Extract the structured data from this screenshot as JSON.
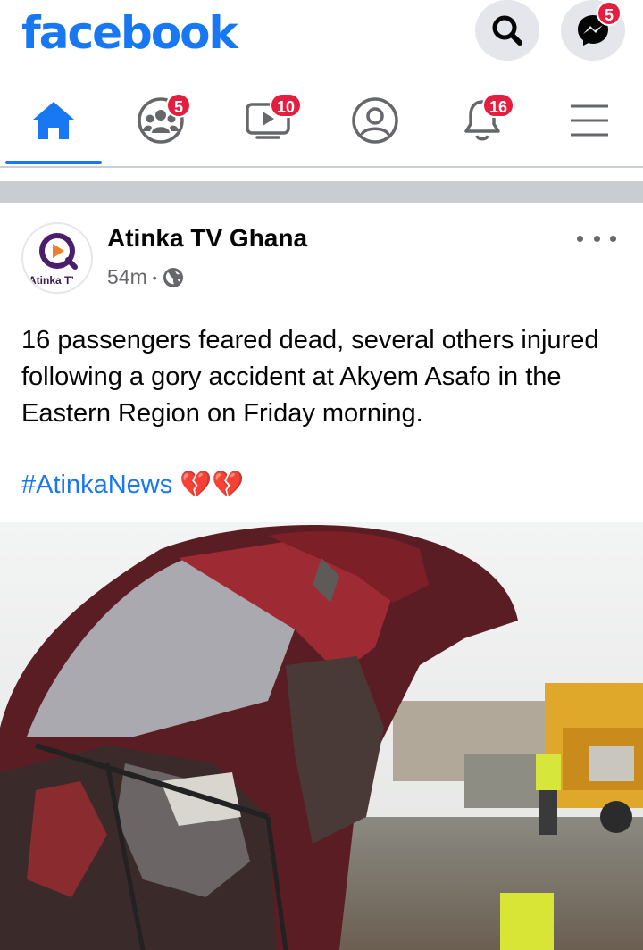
{
  "header": {
    "logo_text": "facebook",
    "messenger_badge": "5"
  },
  "nav": {
    "groups_badge": "5",
    "watch_badge": "10",
    "notifications_badge": "16"
  },
  "post": {
    "page_name": "Atinka TV Ghana",
    "avatar_text": "Atinka T’",
    "time": "54m",
    "dot": "•",
    "text": "16 passengers feared  dead, several others injured following a gory accident at Akyem Asafo  in the Eastern Region on Friday morning.",
    "hashtag": "#AtinkaNews",
    "emoji": "💔💔"
  },
  "colors": {
    "brand": "#1877f2",
    "badge": "#e41e3f",
    "icon_gray": "#65676b",
    "divider": "#c9ccd1"
  },
  "icons": [
    "search-icon",
    "messenger-icon",
    "home-icon",
    "groups-icon",
    "watch-icon",
    "profile-icon",
    "bell-icon",
    "menu-icon",
    "globe-icon",
    "more-icon"
  ]
}
